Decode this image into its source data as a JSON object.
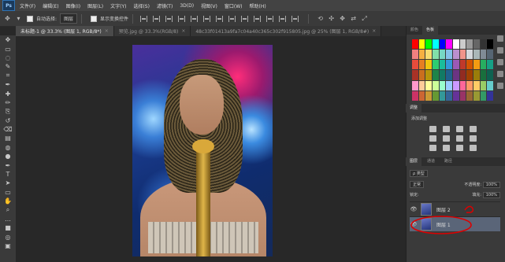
{
  "menu": {
    "logo": "Ps",
    "items": [
      "文件(F)",
      "编辑(E)",
      "图像(I)",
      "图层(L)",
      "文字(Y)",
      "选择(S)",
      "滤镜(T)",
      "3D(D)",
      "视图(V)",
      "窗口(W)",
      "帮助(H)"
    ]
  },
  "options": {
    "auto_select_label": "自动选择:",
    "auto_select_value": "图层",
    "transform_label": "显示变换控件"
  },
  "tabs": [
    {
      "label": "未标题-1 @ 33.3% (图层 1, RGB/8*)",
      "active": true
    },
    {
      "label": "预览.jpg @ 33.3%(RGB/8)",
      "active": false
    },
    {
      "label": "48c33f01413a9fa7c04a40c365c302f915805.jpg @ 25% (图层 1, RGB/8#)",
      "active": false
    }
  ],
  "tools": [
    "move-icon",
    "marquee-icon",
    "lasso-icon",
    "quick-select-icon",
    "crop-icon",
    "eyedropper-icon",
    "healing-icon",
    "brush-icon",
    "stamp-icon",
    "history-brush-icon",
    "eraser-icon",
    "gradient-icon",
    "blur-icon",
    "dodge-icon",
    "pen-icon",
    "type-icon",
    "path-select-icon",
    "shape-icon",
    "hand-icon",
    "zoom-icon",
    "more-icon",
    "color-swatch-icon",
    "quickmask-icon",
    "screenmode-icon"
  ],
  "panels": {
    "swatches_tabs": [
      "颜色",
      "色板"
    ],
    "adjustments_title": "调整",
    "adjustments_add": "添加调整",
    "layers_tabs": [
      "图层",
      "通道",
      "路径"
    ],
    "kind_label": "ρ 类型",
    "blend_mode": "正常",
    "opacity_label": "不透明度:",
    "opacity_value": "100%",
    "lock_label": "锁定:",
    "fill_label": "填充:",
    "fill_value": "100%"
  },
  "layers": [
    {
      "name": "图层 2",
      "selected": false
    },
    {
      "name": "图层 1",
      "selected": true
    }
  ],
  "swatch_colors": [
    "#ff0000",
    "#ffff00",
    "#00ff00",
    "#00ffff",
    "#0000ff",
    "#ff00ff",
    "#ffffff",
    "#cccccc",
    "#999999",
    "#666666",
    "#333333",
    "#000000",
    "#f08080",
    "#f5b041",
    "#f7dc6f",
    "#82e0aa",
    "#76d7c4",
    "#85c1e9",
    "#bb8fce",
    "#f1948a",
    "#d5d8dc",
    "#aab7b8",
    "#808b96",
    "#566573",
    "#e74c3c",
    "#e67e22",
    "#f1c40f",
    "#2ecc71",
    "#1abc9c",
    "#3498db",
    "#9b59b6",
    "#c0392b",
    "#d35400",
    "#f39c12",
    "#27ae60",
    "#16a085",
    "#a93226",
    "#ca6f1e",
    "#b7950b",
    "#1e8449",
    "#117a65",
    "#1f618d",
    "#6c3483",
    "#922b21",
    "#a04000",
    "#9a7d0a",
    "#196f3d",
    "#0e6251",
    "#ff99cc",
    "#ffcc99",
    "#ffff99",
    "#ccff99",
    "#99ffcc",
    "#99ccff",
    "#cc99ff",
    "#ff6699",
    "#ff9966",
    "#ffcc66",
    "#99cc66",
    "#66cccc",
    "#cc3366",
    "#cc6633",
    "#cc9933",
    "#669933",
    "#339999",
    "#336699",
    "#663399",
    "#993366",
    "#996633",
    "#999933",
    "#339966",
    "#333399"
  ]
}
